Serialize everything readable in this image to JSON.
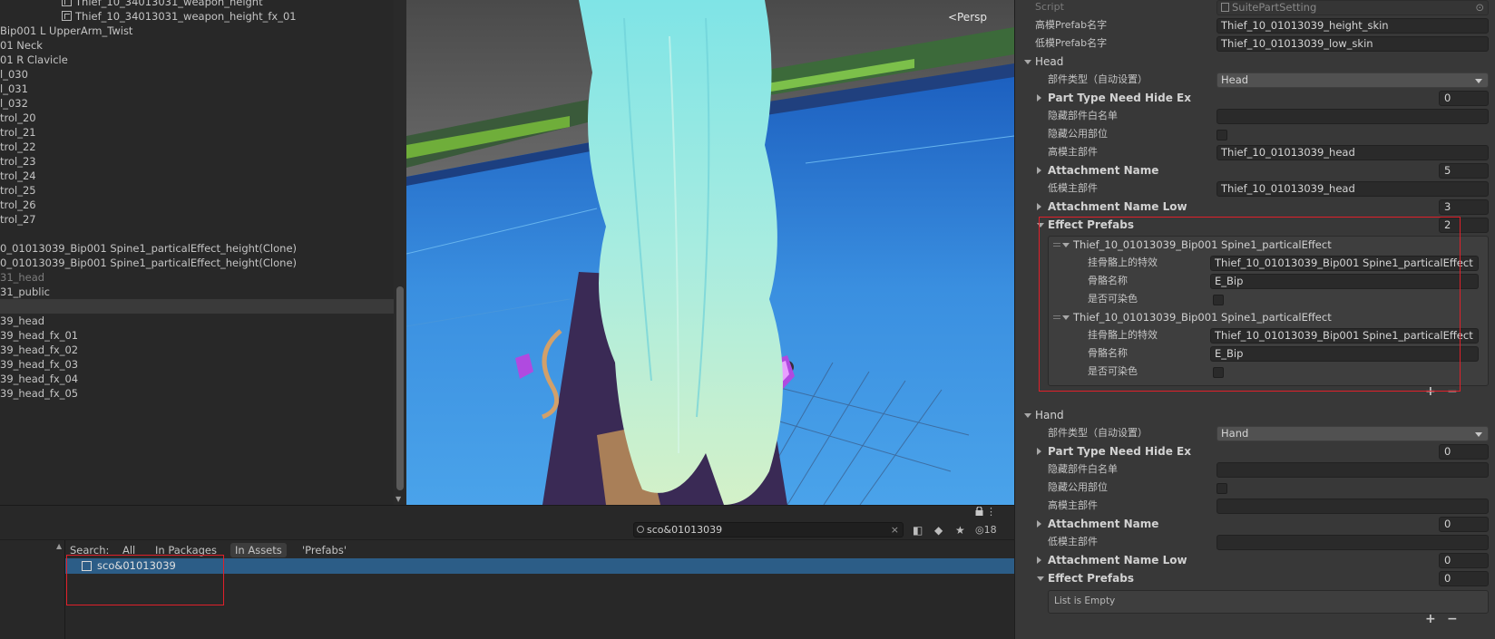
{
  "hierarchy": {
    "items": [
      {
        "label": "Thief_10_34013031_weapon_height",
        "icon": "prefab-icon",
        "dim": false
      },
      {
        "label": "Thief_10_34013031_weapon_height_fx_01",
        "icon": "prefab-icon",
        "dim": false
      },
      {
        "label": "Bip001 L UpperArm_Twist",
        "dim": false
      },
      {
        "label": "01 Neck",
        "dim": false
      },
      {
        "label": "01 R Clavicle",
        "dim": false
      },
      {
        "label": "l_030",
        "dim": false
      },
      {
        "label": "l_031",
        "dim": false
      },
      {
        "label": "l_032",
        "dim": false
      },
      {
        "label": "trol_20",
        "dim": false
      },
      {
        "label": "trol_21",
        "dim": false
      },
      {
        "label": "trol_22",
        "dim": false
      },
      {
        "label": "trol_23",
        "dim": false
      },
      {
        "label": "trol_24",
        "dim": false
      },
      {
        "label": "trol_25",
        "dim": false
      },
      {
        "label": "trol_26",
        "dim": false
      },
      {
        "label": "trol_27",
        "dim": false
      },
      {
        "label": "",
        "dim": false
      },
      {
        "label": "0_01013039_Bip001 Spine1_particalEffect_height(Clone)",
        "dim": false
      },
      {
        "label": "0_01013039_Bip001 Spine1_particalEffect_height(Clone)",
        "dim": false
      },
      {
        "label": "31_head",
        "dim": true
      },
      {
        "label": "31_public",
        "dim": false
      },
      {
        "label": "",
        "dim": false,
        "selected": true
      },
      {
        "label": "39_head",
        "dim": false
      },
      {
        "label": "39_head_fx_01",
        "dim": false
      },
      {
        "label": "39_head_fx_02",
        "dim": false
      },
      {
        "label": "39_head_fx_03",
        "dim": false
      },
      {
        "label": "39_head_fx_04",
        "dim": false
      },
      {
        "label": "39_head_fx_05",
        "dim": false
      }
    ]
  },
  "scene": {
    "projection_label": "Persp",
    "colors": {
      "floor": "#2f86d8",
      "hair": "#a9e8e2",
      "robe": "#3a2a55",
      "gem": "#b04ae0"
    }
  },
  "project": {
    "search_value": "sco&01013039",
    "hidden_count": "18",
    "filters": {
      "search": "Search:",
      "all": "All",
      "in_packages": "In Packages",
      "in_assets": "In Assets",
      "prefabs": "'Prefabs'"
    },
    "result": "sco&01013039"
  },
  "inspector": {
    "script_label": "Script",
    "script_value": "SuitePartSetting",
    "high_prefab_label": "高模Prefab名字",
    "high_prefab_value": "Thief_10_01013039_height_skin",
    "low_prefab_label": "低模Prefab名字",
    "low_prefab_value": "Thief_10_01013039_low_skin",
    "head": {
      "title": "Head",
      "part_type_label": "部件类型（自动设置）",
      "part_type_value": "Head",
      "hide_ex_label": "Part Type Need Hide Ex",
      "hide_ex_value": "0",
      "whitelist_label": "隐藏部件白名单",
      "hide_public_label": "隐藏公用部位",
      "high_main_label": "高模主部件",
      "high_main_value": "Thief_10_01013039_head",
      "attach_label": "Attachment Name",
      "attach_value": "5",
      "low_main_label": "低模主部件",
      "low_main_value": "Thief_10_01013039_head",
      "attach_low_label": "Attachment Name Low",
      "attach_low_value": "3",
      "effect_label": "Effect Prefabs",
      "effect_value": "2",
      "effects": [
        {
          "title": "Thief_10_01013039_Bip001 Spine1_particalEffect",
          "bone_fx_label": "挂骨骼上的特效",
          "bone_fx_value": "Thief_10_01013039_Bip001 Spine1_particalEffect",
          "bone_name_label": "骨骼名称",
          "bone_name_value": "E_Bip",
          "dyeable_label": "是否可染色"
        },
        {
          "title": "Thief_10_01013039_Bip001 Spine1_particalEffect",
          "bone_fx_label": "挂骨骼上的特效",
          "bone_fx_value": "Thief_10_01013039_Bip001 Spine1_particalEffect",
          "bone_name_label": "骨骼名称",
          "bone_name_value": "E_Bip",
          "dyeable_label": "是否可染色"
        }
      ]
    },
    "hand": {
      "title": "Hand",
      "part_type_label": "部件类型（自动设置）",
      "part_type_value": "Hand",
      "hide_ex_label": "Part Type Need Hide Ex",
      "hide_ex_value": "0",
      "whitelist_label": "隐藏部件白名单",
      "hide_public_label": "隐藏公用部位",
      "high_main_label": "高模主部件",
      "attach_label": "Attachment Name",
      "attach_value": "0",
      "low_main_label": "低模主部件",
      "attach_low_label": "Attachment Name Low",
      "attach_low_value": "0",
      "effect_label": "Effect Prefabs",
      "effect_value": "0",
      "empty_label": "List is Empty"
    },
    "plus": "+",
    "minus": "−"
  },
  "annotation_color": "#e0202a"
}
